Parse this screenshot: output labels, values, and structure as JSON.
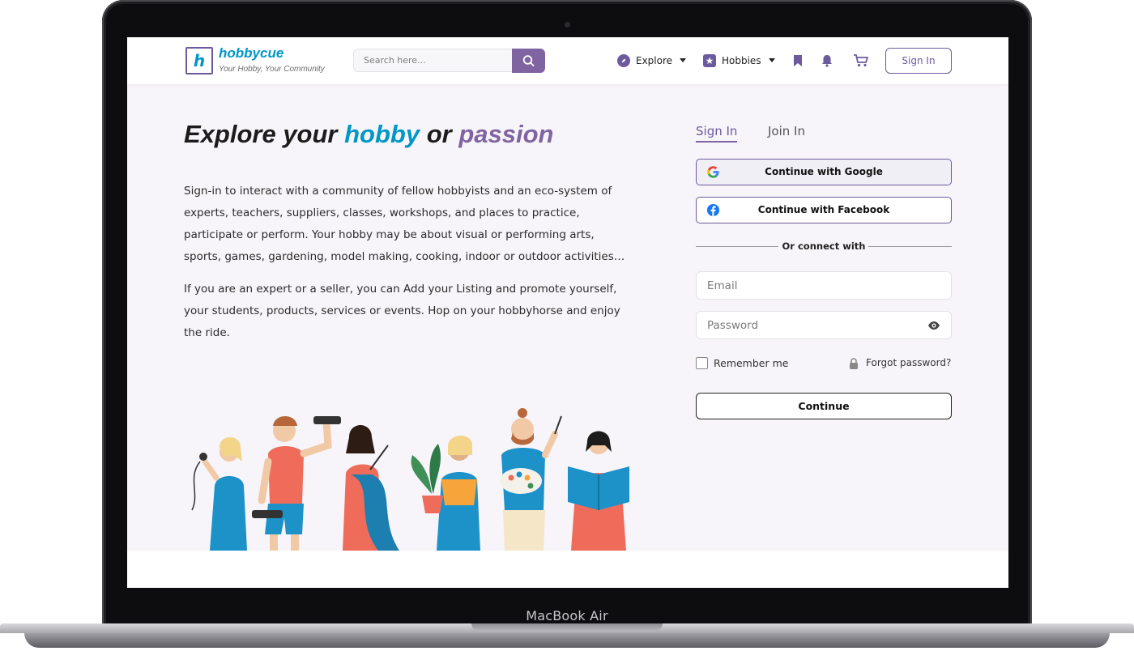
{
  "device": {
    "label": "MacBook Air"
  },
  "brand": {
    "logo_letter": "h",
    "name": "hobbycue",
    "tagline": "Your Hobby, Your Community",
    "accent": "#0096c7",
    "primary": "#8064a2"
  },
  "navbar": {
    "search_placeholder": "Search here...",
    "search_icon": "search-icon",
    "explore_label": "Explore",
    "hobbies_label": "Hobbies",
    "icons": [
      "compass-icon",
      "hobbies-icon",
      "bookmark-icon",
      "bell-icon",
      "cart-icon"
    ],
    "signin_label": "Sign In"
  },
  "hero": {
    "title_part1": "Explore your ",
    "title_hobby": "hobby",
    "title_part2": " or ",
    "title_passion": "passion",
    "paragraph1": "Sign-in to interact with a community of fellow hobbyists and an eco-system of experts, teachers, suppliers, classes, workshops, and places to practice, participate or perform. Your hobby may be about visual or performing arts, sports, games, gardening, model making, cooking, indoor or outdoor activities…",
    "paragraph2": "If you are an expert or a seller, you can Add your Listing and promote yourself, your students, products, services or events. Hop on your hobbyhorse and enjoy the ride."
  },
  "auth": {
    "tab_signin": "Sign In",
    "tab_joinin": "Join In",
    "google_label": "Continue with Google",
    "facebook_label": "Continue with Facebook",
    "divider_label": "Or connect with",
    "email_placeholder": "Email",
    "password_placeholder": "Password",
    "remember_label": "Remember me",
    "forgot_label": "Forgot password?",
    "continue_label": "Continue"
  }
}
